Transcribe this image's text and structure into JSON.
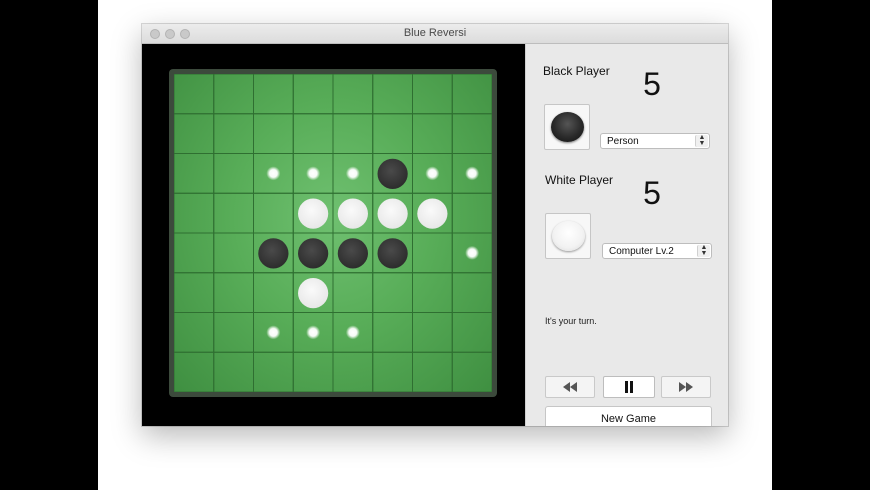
{
  "window": {
    "title": "Blue Reversi"
  },
  "black_player": {
    "label": "Black Player",
    "score": "5",
    "type_select": "Person"
  },
  "white_player": {
    "label": "White Player",
    "score": "5",
    "type_select": "Computer Lv.2"
  },
  "status": "It's your turn.",
  "controls": {
    "rewind_icon": "rewind-icon",
    "pause_icon": "pause-icon",
    "forward_icon": "fast-forward-icon",
    "new_game_label": "New Game"
  },
  "board": {
    "size": 8,
    "colors": {
      "board_green": "#58ad58",
      "grid_line": "#2f6f31",
      "black_disc": "#2a2a2a",
      "white_disc": "#e6e6e6",
      "hint_dot": "#ffffff"
    },
    "pieces": [
      {
        "row": 2,
        "col": 5,
        "color": "black"
      },
      {
        "row": 3,
        "col": 3,
        "color": "white"
      },
      {
        "row": 3,
        "col": 4,
        "color": "white"
      },
      {
        "row": 3,
        "col": 5,
        "color": "white"
      },
      {
        "row": 3,
        "col": 6,
        "color": "white"
      },
      {
        "row": 4,
        "col": 2,
        "color": "black"
      },
      {
        "row": 4,
        "col": 3,
        "color": "black"
      },
      {
        "row": 4,
        "col": 4,
        "color": "black"
      },
      {
        "row": 4,
        "col": 5,
        "color": "black"
      },
      {
        "row": 5,
        "col": 3,
        "color": "white"
      }
    ],
    "valid_moves": [
      {
        "row": 2,
        "col": 2
      },
      {
        "row": 2,
        "col": 3
      },
      {
        "row": 2,
        "col": 4
      },
      {
        "row": 2,
        "col": 6
      },
      {
        "row": 2,
        "col": 7
      },
      {
        "row": 4,
        "col": 7
      },
      {
        "row": 6,
        "col": 2
      },
      {
        "row": 6,
        "col": 3
      },
      {
        "row": 6,
        "col": 4
      }
    ]
  }
}
